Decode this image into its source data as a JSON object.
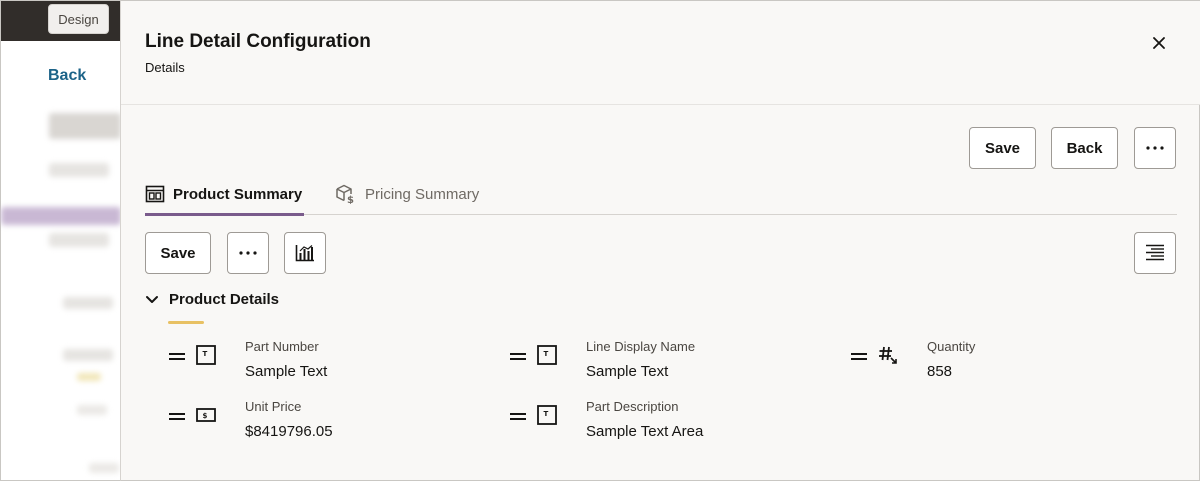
{
  "background": {
    "design_tag": "Design",
    "back_link": "Back"
  },
  "drawer": {
    "title": "Line Detail Configuration",
    "subtitle": "Details",
    "toolbar": {
      "save_label": "Save",
      "back_label": "Back",
      "more_label": "···"
    },
    "tabs": [
      {
        "label": "Product Summary",
        "icon": "layout-icon",
        "active": true
      },
      {
        "label": "Pricing Summary",
        "icon": "pricing-box-icon",
        "active": false
      }
    ],
    "section_toolbar": {
      "save_label": "Save",
      "more_label": "···",
      "chart_icon": "bar-chart-icon",
      "align_icon": "align-right-icon"
    },
    "section": {
      "title": "Product Details",
      "accent_color": "#e8c163"
    },
    "fields": [
      {
        "label": "Part Number",
        "value": "Sample Text",
        "type_icon": "text-field-icon"
      },
      {
        "label": "Line Display Name",
        "value": "Sample Text",
        "type_icon": "text-field-icon"
      },
      {
        "label": "Quantity",
        "value": "858",
        "type_icon": "number-field-icon"
      },
      {
        "label": "Unit Price",
        "value": "$8419796.05",
        "type_icon": "currency-field-icon"
      },
      {
        "label": "Part Description",
        "value": "Sample Text Area",
        "type_icon": "text-field-icon"
      }
    ]
  },
  "colors": {
    "tab_active_underline": "#7a5b8c",
    "link": "#1c6388",
    "drawer_bg": "#f9f8f6"
  }
}
